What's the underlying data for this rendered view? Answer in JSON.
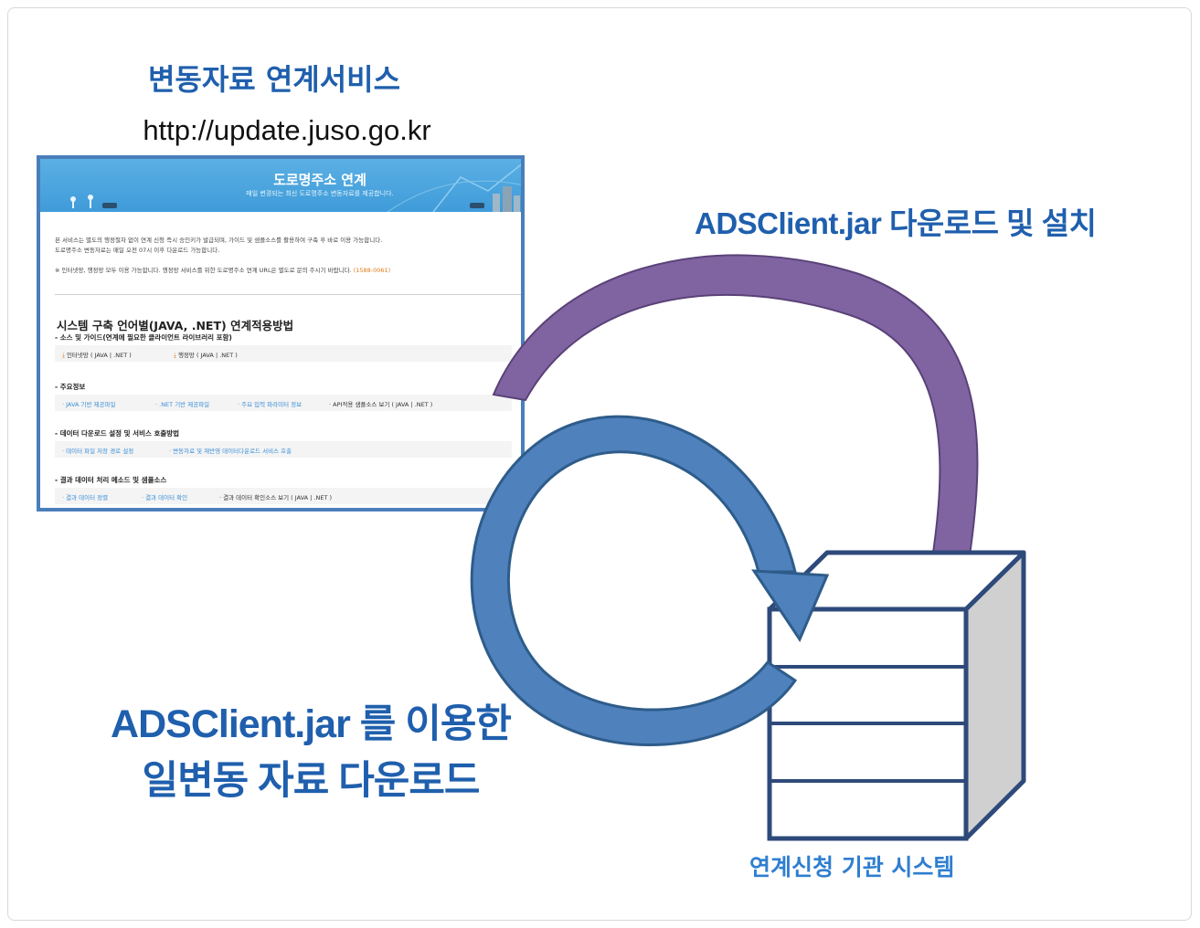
{
  "service": {
    "title": "변동자료 연계서비스",
    "url": "http://update.juso.go.kr"
  },
  "right_caption": "ADSClient.jar 다운로드 및 설치",
  "left_caption": {
    "line1": "ADSClient.jar 를 이용한",
    "line2": "일변동 자료 다운로드"
  },
  "system_label": "연계신청 기관 시스템",
  "colors": {
    "caption_blue": "#1f5fad",
    "label_blue": "#2f7fd0",
    "arrow_blue": "#4f81bd",
    "arrow_purple": "#8064a2",
    "server_stroke": "#2e4a7a",
    "server_side": "#d0d0d0"
  },
  "website": {
    "banner_title": "도로명주소 연계",
    "banner_subtitle": "매일 변경되는 최신 도로명주소 변동자료를 제공합니다.",
    "intro_line1": "본 서비스는 별도의 행정절차 없이 연계 신청 즉시 승인키가 발급되며, 가이드 및 샘플소스를 활용하여 구축 후 바로 이용 가능합니다.",
    "intro_line2": "도로명주소 변동자료는 매일 오전 07시 이후 다운로드 가능합니다.",
    "note": "※ 인터넷망, 행정망 모두 이용 가능합니다. 행정망 서비스를 위한 도로명주소 연계 URL은 별도로 문의 주시기 바랍니다.",
    "note_phone": "(1588-0061)",
    "heading": "시스템 구축 언어별(JAVA, .NET) 연계적용방법",
    "section1": {
      "title": "- 소스 및 가이드(연계에 필요한 클라이언트 라이브러리 포함)",
      "links": [
        "인터넷망 ( JAVA | .NET )",
        "행정망 ( JAVA | .NET )"
      ]
    },
    "section2": {
      "title": "- 주요정보",
      "links": [
        "· JAVA 기반 제공파일",
        "· .NET 기반 제공파일",
        "· 주요 입력 파라미터 정보",
        "· API적용 샘플소스 보기 ( JAVA | .NET )"
      ]
    },
    "section3": {
      "title": "- 데이터 다운로드 설정 및 서비스 호출방법",
      "links": [
        "· 데이터 파일 저장 경로 설정",
        "· 변동자료 및 재반영 데이터다운로드 서비스 호출"
      ]
    },
    "section4": {
      "title": "- 결과 데이터 처리 메소드 및 샘플소스",
      "links": [
        "· 결과 데이터 정렬",
        "· 결과 데이터 확인",
        "· 결과 데이터 확인소스 보기 ( JAVA | .NET )"
      ]
    }
  }
}
